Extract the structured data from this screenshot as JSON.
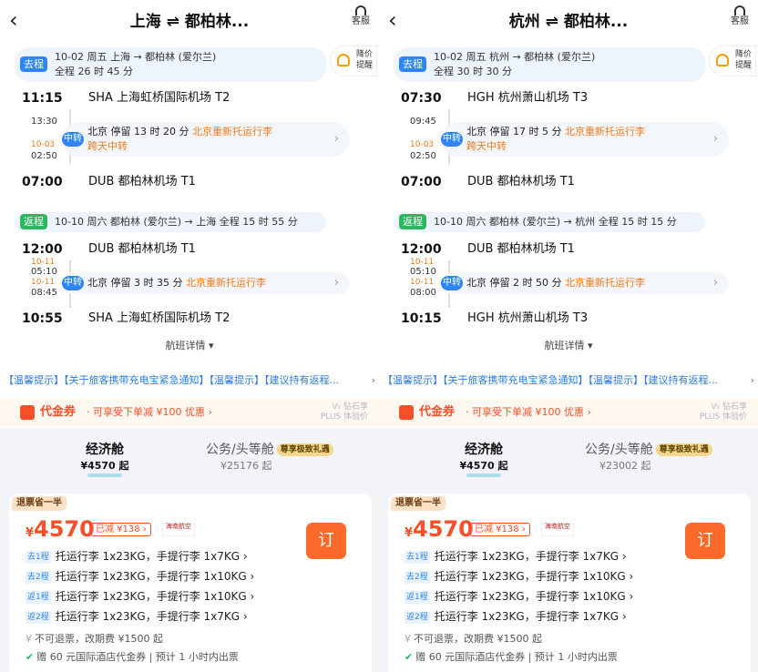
{
  "panels": [
    {
      "title": "上海 ⇌ 都柏林...",
      "service": "客服",
      "outbound": {
        "badge": "去程",
        "line1": "10-02 周五   上海 → 都柏林 (爱尔兰)",
        "line2": "全程 26 时 45 分",
        "dep_time": "11:15",
        "dep_airport": "SHA 上海虹桥国际机场 T2",
        "transit_arr": "13:30",
        "transit_next_date": "10-03",
        "transit_dep": "02:50",
        "transit_badge": "中转",
        "transit_text": "北京  停留 13 时 20 分",
        "transit_warn": "北京重新托运行李",
        "transit_extra": "跨天中转",
        "arr_time": "07:00",
        "arr_airport": "DUB 都柏林机场 T1"
      },
      "notify_label": "降价提醒",
      "inbound": {
        "badge": "返程",
        "line": "10-10 周六   都柏林 (爱尔兰) → 上海    全程 15 时 55 分",
        "dep_time": "12:00",
        "dep_airport": "DUB 都柏林机场 T1",
        "transit_arr_date": "10-11",
        "transit_arr": "05:10",
        "transit_dep_date": "10-11",
        "transit_dep": "08:45",
        "transit_badge": "中转",
        "transit_text": "北京  停留 3 时 35 分",
        "transit_warn": "北京重新托运行李",
        "arr_time": "10:55",
        "arr_airport": "SHA 上海虹桥国际机场 T2"
      },
      "detail": "航班详情 ▾",
      "notice": "【温馨提示】【关于旅客携带充电宝紧急通知】【温馨提示】【建议持有返程...",
      "coupon_name": "代金券",
      "coupon_desc": "· 可享受下单减 ¥100 优惠  ›",
      "plus_line1": "V₅ 钻石享",
      "plus_line2": "PLUS 体验价",
      "tab_economy": "经济舱",
      "tab_economy_price": "¥4570 起",
      "tab_business": "公务/头等舱",
      "tab_business_vip": "尊享极致礼遇",
      "tab_business_price": "¥25176 起",
      "card_tag": "退票省一半",
      "price": "4570",
      "discount": "已减 ¥138 ›",
      "airline": "海南航空",
      "book": "订",
      "bags": [
        {
          "leg": "去1程",
          "text": "托运行李 1x23KG，手提行李 1x7KG ›"
        },
        {
          "leg": "去2程",
          "text": "托运行李 1x23KG，手提行李 1x10KG ›"
        },
        {
          "leg": "返1程",
          "text": "托运行李 1x23KG，手提行李 1x10KG ›"
        },
        {
          "leg": "返2程",
          "text": "托运行李 1x23KG，手提行李 1x7KG ›"
        }
      ],
      "rule1": "不可退票，改期费 ¥1500 起",
      "rule2": "赠 60 元国际酒店代金券 | 预计 1 小时内出票"
    },
    {
      "title": "杭州 ⇌ 都柏林...",
      "service": "客服",
      "outbound": {
        "badge": "去程",
        "line1": "10-02 周五   杭州 → 都柏林 (爱尔兰)",
        "line2": "全程 30 时 30 分",
        "dep_time": "07:30",
        "dep_airport": "HGH 杭州萧山机场 T3",
        "transit_arr": "09:45",
        "transit_next_date": "10-03",
        "transit_dep": "02:50",
        "transit_badge": "中转",
        "transit_text": "北京  停留 17 时 5 分",
        "transit_warn": "北京重新托运行李",
        "transit_extra": "跨天中转",
        "arr_time": "07:00",
        "arr_airport": "DUB 都柏林机场 T1"
      },
      "notify_label": "降价提醒",
      "inbound": {
        "badge": "返程",
        "line": "10-10 周六   都柏林 (爱尔兰) → 杭州    全程 15 时 15 分",
        "dep_time": "12:00",
        "dep_airport": "DUB 都柏林机场 T1",
        "transit_arr_date": "10-11",
        "transit_arr": "05:10",
        "transit_dep_date": "10-11",
        "transit_dep": "08:00",
        "transit_badge": "中转",
        "transit_text": "北京  停留 2 时 50 分",
        "transit_warn": "北京重新托运行李",
        "arr_time": "10:15",
        "arr_airport": "HGH 杭州萧山机场 T3"
      },
      "detail": "航班详情 ▾",
      "notice": "【温馨提示】【关于旅客携带充电宝紧急通知】【温馨提示】【建议持有返程...",
      "coupon_name": "代金券",
      "coupon_desc": "· 可享受下单减 ¥100 优惠  ›",
      "plus_line1": "V₅ 钻石享",
      "plus_line2": "PLUS 体验价",
      "tab_economy": "经济舱",
      "tab_economy_price": "¥4570 起",
      "tab_business": "公务/头等舱",
      "tab_business_vip": "尊享极致礼遇",
      "tab_business_price": "¥23002 起",
      "card_tag": "退票省一半",
      "price": "4570",
      "discount": "已减 ¥138 ›",
      "airline": "海南航空",
      "book": "订",
      "bags": [
        {
          "leg": "去1程",
          "text": "托运行李 1x23KG，手提行李 1x7KG ›"
        },
        {
          "leg": "去2程",
          "text": "托运行李 1x23KG，手提行李 1x10KG ›"
        },
        {
          "leg": "返1程",
          "text": "托运行李 1x23KG，手提行李 1x10KG ›"
        },
        {
          "leg": "返2程",
          "text": "托运行李 1x23KG，手提行李 1x7KG ›"
        }
      ],
      "rule1": "不可退票，改期费 ¥1500 起",
      "rule2": "赠 60 元国际酒店代金券 | 预计 1 小时内出票"
    }
  ]
}
